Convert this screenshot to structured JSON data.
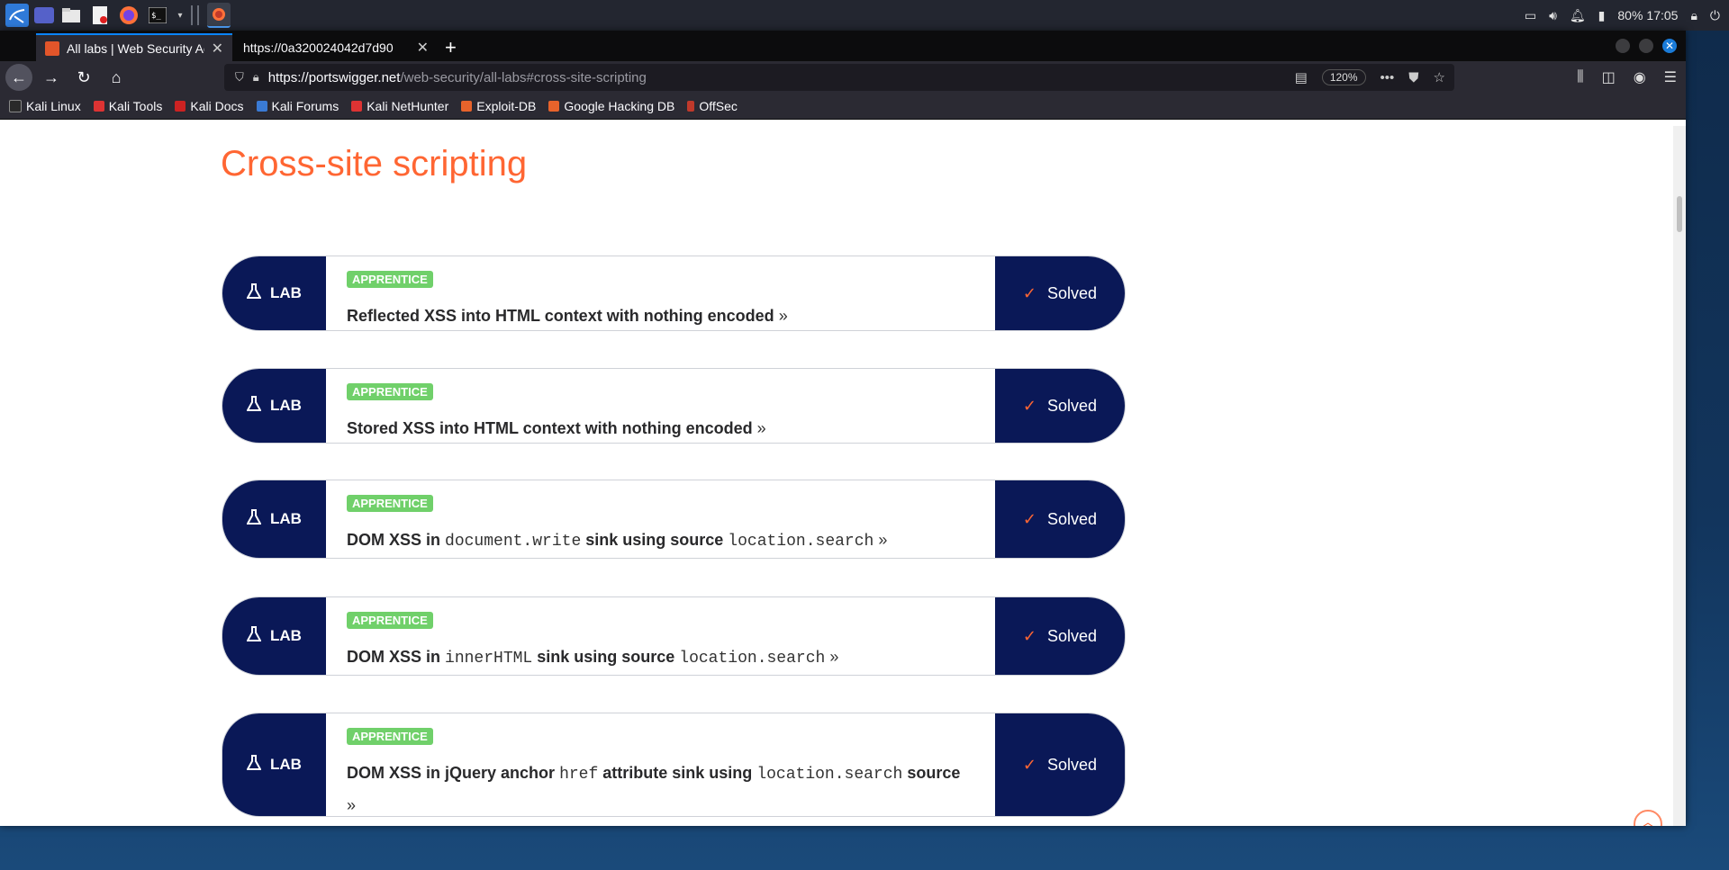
{
  "taskbar": {
    "battery": "80%",
    "clock": "17:05"
  },
  "browser": {
    "tabs": [
      {
        "title": "All labs | Web Security Ac"
      },
      {
        "title": "https://0a320024042d7d90"
      }
    ],
    "url_host": "https://portswigger.net",
    "url_path": "/web-security/all-labs#cross-site-scripting",
    "zoom": "120%",
    "bookmarks": [
      "Kali Linux",
      "Kali Tools",
      "Kali Docs",
      "Kali Forums",
      "Kali NetHunter",
      "Exploit-DB",
      "Google Hacking DB",
      "OffSec"
    ]
  },
  "page": {
    "section_title": "Cross-site scripting",
    "lab_badge": "LAB",
    "solved_label": "Solved",
    "labs": [
      {
        "level": "APPRENTICE",
        "title_parts": [
          {
            "t": "Reflected XSS into HTML context with nothing encoded"
          }
        ]
      },
      {
        "level": "APPRENTICE",
        "title_parts": [
          {
            "t": "Stored XSS into HTML context with nothing encoded"
          }
        ]
      },
      {
        "level": "APPRENTICE",
        "title_parts": [
          {
            "t": "DOM XSS in "
          },
          {
            "c": "document.write"
          },
          {
            "t": " sink using source "
          },
          {
            "c": "location.search"
          }
        ]
      },
      {
        "level": "APPRENTICE",
        "title_parts": [
          {
            "t": "DOM XSS in "
          },
          {
            "c": "innerHTML"
          },
          {
            "t": " sink using source "
          },
          {
            "c": "location.search"
          }
        ]
      },
      {
        "level": "APPRENTICE",
        "title_parts": [
          {
            "t": "DOM XSS in jQuery anchor "
          },
          {
            "c": "href"
          },
          {
            "t": " attribute sink using "
          },
          {
            "c": "location.search"
          },
          {
            "t": " source"
          }
        ]
      }
    ]
  }
}
